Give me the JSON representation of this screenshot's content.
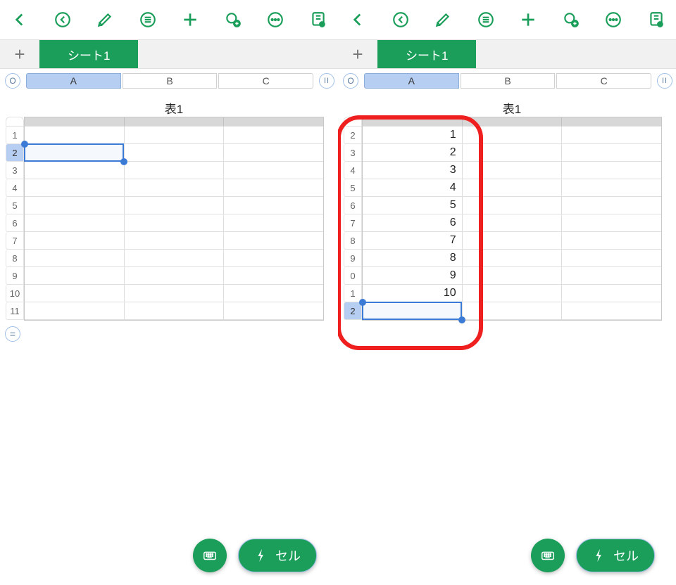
{
  "left": {
    "sheet_tab": "シート1",
    "columns": [
      "A",
      "B",
      "C"
    ],
    "selected_col": 0,
    "title": "表1",
    "row_labels": [
      "1",
      "2",
      "3",
      "4",
      "5",
      "6",
      "7",
      "8",
      "9",
      "10",
      "11"
    ],
    "selected_row_index": 1,
    "cells": [
      [
        "",
        "",
        ""
      ],
      [
        "",
        "",
        ""
      ],
      [
        "",
        "",
        ""
      ],
      [
        "",
        "",
        ""
      ],
      [
        "",
        "",
        ""
      ],
      [
        "",
        "",
        ""
      ],
      [
        "",
        "",
        ""
      ],
      [
        "",
        "",
        ""
      ],
      [
        "",
        "",
        ""
      ],
      [
        "",
        "",
        ""
      ],
      [
        "",
        "",
        ""
      ]
    ],
    "fab_cell": "セル",
    "o": "O",
    "ii": "II",
    "eq": "="
  },
  "right": {
    "sheet_tab": "シート1",
    "columns": [
      "A",
      "B",
      "C"
    ],
    "selected_col": 0,
    "title": "表1",
    "row_labels": [
      "2",
      "3",
      "4",
      "5",
      "6",
      "7",
      "8",
      "9",
      "0",
      "1",
      "2"
    ],
    "selected_row_index": 10,
    "cells": [
      [
        "1",
        "",
        ""
      ],
      [
        "2",
        "",
        ""
      ],
      [
        "3",
        "",
        ""
      ],
      [
        "4",
        "",
        ""
      ],
      [
        "5",
        "",
        ""
      ],
      [
        "6",
        "",
        ""
      ],
      [
        "7",
        "",
        ""
      ],
      [
        "8",
        "",
        ""
      ],
      [
        "9",
        "",
        ""
      ],
      [
        "10",
        "",
        ""
      ],
      [
        "",
        "",
        ""
      ]
    ],
    "fab_cell": "セル",
    "o": "O",
    "ii": "II"
  },
  "icons": {
    "back": "back",
    "undo": "undo",
    "brush": "brush",
    "list": "list",
    "add": "add",
    "share": "share",
    "more": "more",
    "note": "note",
    "keyboard": "keyboard",
    "bolt": "bolt"
  }
}
